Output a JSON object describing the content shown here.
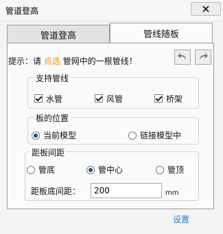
{
  "window": {
    "title": "管道登高"
  },
  "tabs": [
    {
      "label": "管道登高"
    },
    {
      "label": "管线随板"
    }
  ],
  "hint": {
    "prefix": "提示：请",
    "highlight": "点选",
    "suffix": "管网中的一根管线！"
  },
  "support_group": {
    "title": "支持管线",
    "items": [
      {
        "label": "水管",
        "checked": true
      },
      {
        "label": "风管",
        "checked": true
      },
      {
        "label": "桥架",
        "checked": true
      }
    ]
  },
  "position_group": {
    "title": "板的位置",
    "options": [
      {
        "label": "当前模型",
        "selected": true
      },
      {
        "label": "链接模型中",
        "selected": false
      }
    ]
  },
  "distance_group": {
    "title": "距板间距",
    "options": [
      {
        "label": "管底",
        "selected": false
      },
      {
        "label": "管中心",
        "selected": true
      },
      {
        "label": "管顶",
        "selected": false
      }
    ],
    "field_label": "距板底间距：",
    "value": "200",
    "unit": "mm"
  },
  "footer": {
    "settings_label": "设置"
  },
  "colors": {
    "hint_highlight": "#ff8a00",
    "link": "#2b78c7"
  },
  "icons": {
    "close": "close-icon",
    "undo": "undo-arrow-icon",
    "redo": "redo-arrow-icon"
  }
}
